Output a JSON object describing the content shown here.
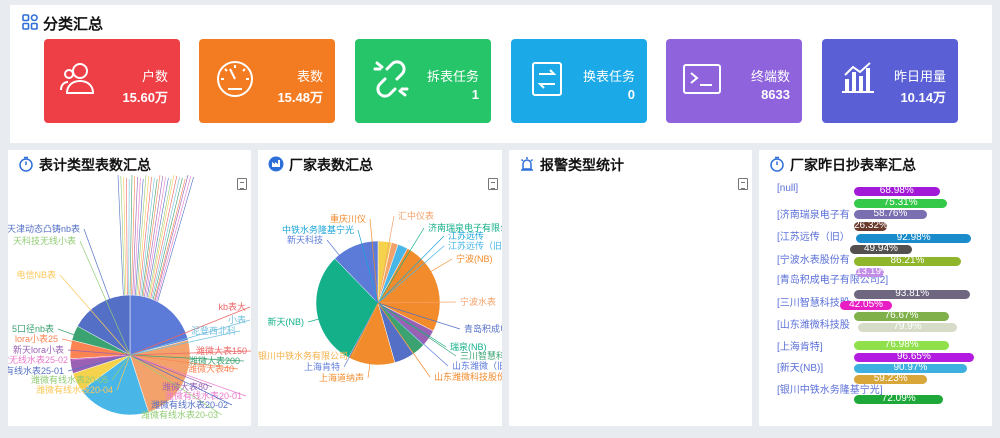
{
  "summary": {
    "title": "分类汇总",
    "cards": [
      {
        "label": "户数",
        "value": "15.60万",
        "color": "#ef3f46",
        "icon": "users-icon"
      },
      {
        "label": "表数",
        "value": "15.48万",
        "color": "#f37b22",
        "icon": "gauge-icon"
      },
      {
        "label": "拆表任务",
        "value": "1",
        "color": "#27c56a",
        "icon": "broken-link-icon"
      },
      {
        "label": "换表任务",
        "value": "0",
        "color": "#1ba9e8",
        "icon": "swap-icon"
      },
      {
        "label": "终端数",
        "value": "8633",
        "color": "#8e63dc",
        "icon": "terminal-icon"
      },
      {
        "label": "昨日用量",
        "value": "10.14万",
        "color": "#5a5fd6",
        "icon": "bar-chart-icon"
      }
    ]
  },
  "meter_type": {
    "title": "表计类型表数汇总",
    "chart_data": {
      "type": "pie",
      "labels_visible": [
        "天津动态凸铸nb表",
        "天科技无线小表",
        "电信NB表",
        "kb表大",
        "小表",
        "5口径nb表",
        "lora小表25",
        "新天lora小表",
        "潍微无线水表25-02",
        "潍微有线水表25-01",
        "潍微有线水表20-05",
        "潍微有线水表20-04",
        "潍微大表150",
        "泥登西北科",
        "潍微大表200",
        "潍微大表40",
        "潍微大表80",
        "潍微有线水表20-01",
        "潍微有线水表20-02",
        "潍微有线水表20-03"
      ],
      "slices": [
        {
          "value": 21,
          "color": "#5c7bd9"
        },
        {
          "value": 24,
          "color": "#f4a26b"
        },
        {
          "value": 20,
          "color": "#49b6e8"
        },
        {
          "value": 5,
          "color": "#f5d24b"
        },
        {
          "value": 4,
          "color": "#9a60b4"
        },
        {
          "value": 5,
          "color": "#fc8452"
        },
        {
          "value": 4,
          "color": "#3ba272"
        },
        {
          "value": 17,
          "color": "#5470c6"
        }
      ]
    }
  },
  "manufacturer": {
    "title": "厂家表数汇总",
    "chart_data": {
      "type": "pie",
      "labels": [
        "重庆川仪",
        "汇中仪表",
        "济南瑞泉电子有限公",
        "江苏远传",
        "江苏远传（旧）",
        "宁波(NB)",
        "宁波水表",
        "青岛积成电",
        "瑞泉(NB)",
        "三川智慧科技",
        "山东潍微（旧）",
        "山东潍微科技股份有限",
        "上海肯特",
        "新天(NB)",
        "新天科技",
        "中铁水务隆基宁光",
        "银川中铁水务有限公司",
        "上海道纳声"
      ],
      "slices": [
        {
          "value": 4,
          "color": "#f5d24b"
        },
        {
          "value": 2,
          "color": "#f4a26b"
        },
        {
          "value": 3,
          "color": "#49b6e8"
        },
        {
          "value": 28,
          "color": "#f28b2c"
        },
        {
          "value": 5,
          "color": "#9a60b4"
        },
        {
          "value": 4,
          "color": "#3ba272"
        },
        {
          "value": 6,
          "color": "#5470c6"
        },
        {
          "value": 14,
          "color": "#f28b2c"
        },
        {
          "value": 34,
          "color": "#14b08a"
        },
        {
          "value": 14,
          "color": "#5c7bd9"
        }
      ]
    }
  },
  "alarm": {
    "title": "报警类型统计"
  },
  "read_rate": {
    "title": "厂家昨日抄表率汇总",
    "chart_data": {
      "type": "bar",
      "categories": [
        "[null]",
        "[济南瑞泉电子有限公司]",
        "[江苏远传（旧）]",
        "[宁波水表股份有限公司]",
        "[青岛积成电子有限公司2]",
        "[三川智慧科技股份有限公司]",
        "[山东潍微科技股份有限公司]",
        "[上海肯特]",
        "[新天(NB)]",
        "[银川中铁水务隆基宁光]"
      ],
      "labels_shown": [
        "[null]",
        "[济南瑞泉电子有",
        "[江苏远传（旧）",
        "[宁波水表股份有",
        "[青岛积成电子有限公司2]",
        "[三川智慧科技股",
        "[山东潍微科技股",
        "[上海肯特]",
        "[新天(NB)]",
        "[银川中铁水务隆基宁光]"
      ],
      "bars": [
        {
          "value": 68.98,
          "text": "68.98%",
          "color": "#a21ad8"
        },
        {
          "value": 75.31,
          "text": "75.31%",
          "color": "#35c94a"
        },
        {
          "value": 58.76,
          "text": "58.76%",
          "color": "#7a6fb0"
        },
        {
          "value": 26.32,
          "text": "26.32%",
          "color": "#6b3b2e"
        },
        {
          "value": 92.98,
          "text": "92.98%",
          "color": "#1a8ccc"
        },
        {
          "value": 49.94,
          "text": "49.94%",
          "color": "#54504e"
        },
        {
          "value": 86.21,
          "text": "86.21%",
          "color": "#8fb52a"
        },
        {
          "value": 13.19,
          "text": "13.19%",
          "color": "#c28de6"
        },
        {
          "value": 93.81,
          "text": "93.81%",
          "color": "#6f6680"
        },
        {
          "value": 42.05,
          "text": "42.05%",
          "color": "#e81ec4"
        },
        {
          "value": 76.67,
          "text": "76.67%",
          "color": "#7fb04a"
        },
        {
          "value": 79.9,
          "text": "79.9%",
          "color": "#d6dcc7"
        },
        {
          "value": 76.98,
          "text": "76.98%",
          "color": "#8fe04a"
        },
        {
          "value": 96.65,
          "text": "96.65%",
          "color": "#b31be0"
        },
        {
          "value": 90.97,
          "text": "90.97%",
          "color": "#3db0e0"
        },
        {
          "value": 59.23,
          "text": "59.23%",
          "color": "#d9a63a"
        },
        {
          "value": 72.09,
          "text": "72.09%",
          "color": "#1ea83a"
        }
      ]
    }
  }
}
